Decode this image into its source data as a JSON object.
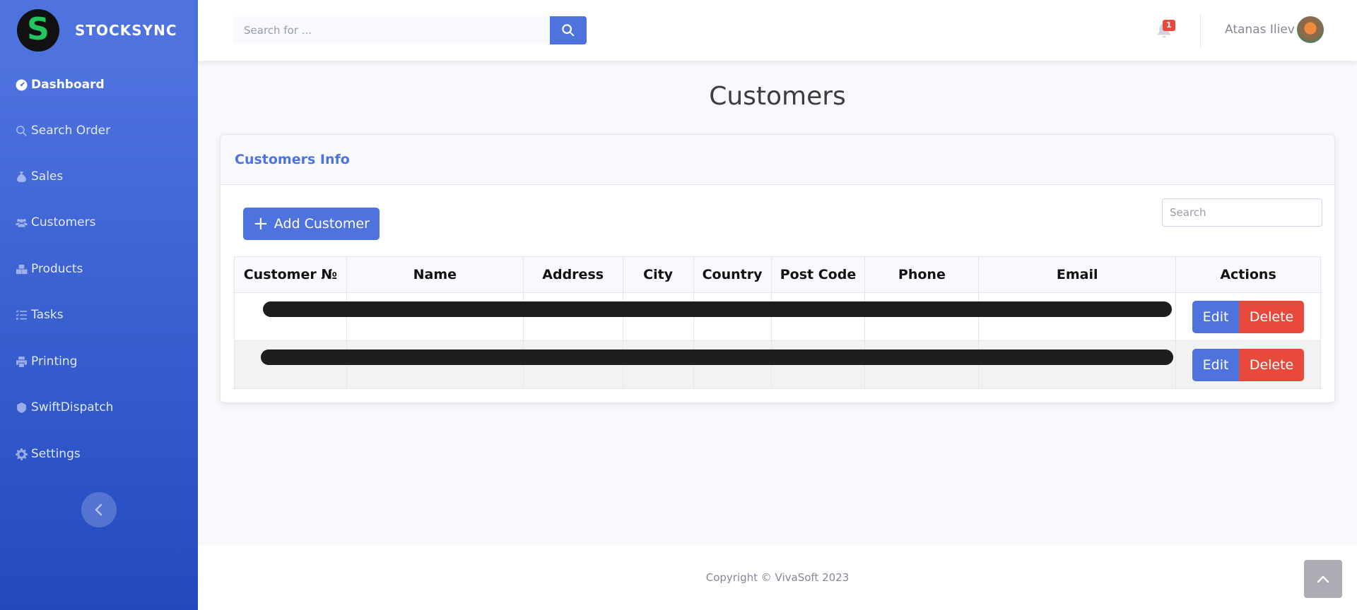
{
  "brand": {
    "logo_letter": "S",
    "name": "STOCKSYNC"
  },
  "sidebar": {
    "items": [
      {
        "label": "Dashboard",
        "icon": "dashboard-icon",
        "active": true
      },
      {
        "label": "Search Order",
        "icon": "search-icon"
      },
      {
        "label": "Sales",
        "icon": "money-bag-icon"
      },
      {
        "label": "Customers",
        "icon": "users-icon"
      },
      {
        "label": "Products",
        "icon": "boxes-icon"
      },
      {
        "label": "Tasks",
        "icon": "task-list-icon"
      },
      {
        "label": "Printing",
        "icon": "printer-icon"
      },
      {
        "label": "SwiftDispatch",
        "icon": "truck-icon"
      },
      {
        "label": "Settings",
        "icon": "gear-icon"
      }
    ],
    "collapse_icon": "chevron-left-icon"
  },
  "topbar": {
    "search_placeholder": "Search for ...",
    "notification_count": "1",
    "user_name": "Atanas Iliev"
  },
  "page": {
    "title": "Customers"
  },
  "card": {
    "title": "Customers Info",
    "add_button": "Add Customer",
    "search_placeholder": "Search",
    "columns": [
      "Customer №",
      "Name",
      "Address",
      "City",
      "Country",
      "Post Code",
      "Phone",
      "Email",
      "Actions"
    ],
    "rows": [
      {
        "redacted": true,
        "edit": "Edit",
        "delete": "Delete"
      },
      {
        "redacted": true,
        "edit": "Edit",
        "delete": "Delete"
      }
    ]
  },
  "footer": {
    "copyright": "Copyright © VivaSoft 2023"
  },
  "colors": {
    "primary": "#4e73df",
    "danger": "#e74a3b",
    "brand_green": "#22c55e"
  }
}
